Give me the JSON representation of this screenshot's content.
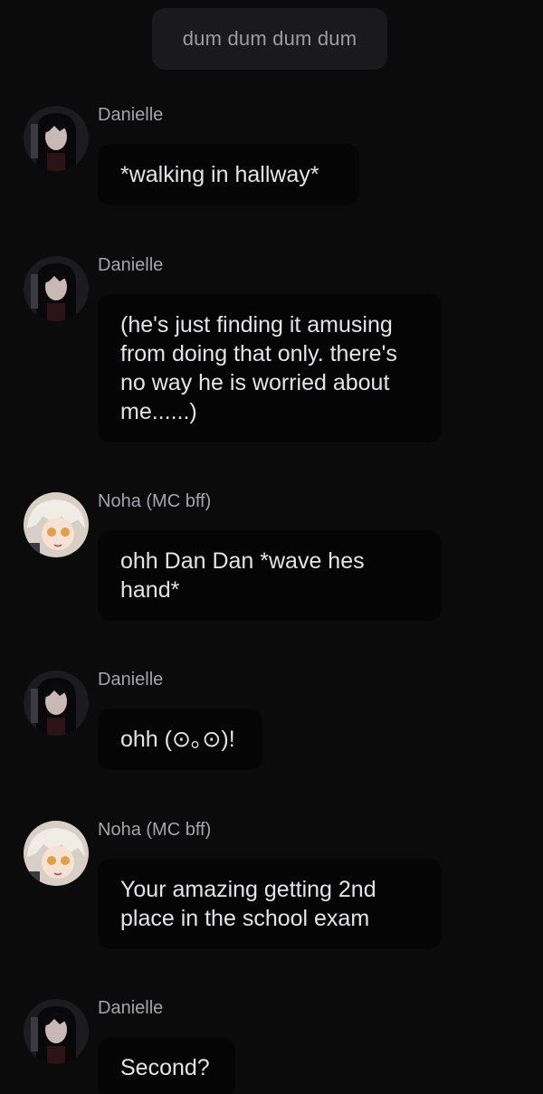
{
  "narration": "dum dum dum dum",
  "messages": [
    {
      "sender": "Danielle",
      "avatar": "danielle-avatar",
      "text": "*walking in hallway*"
    },
    {
      "sender": "Danielle",
      "avatar": "danielle-avatar",
      "text": "(he's just finding it amusing from doing that only. there's no way he is worried about me......)"
    },
    {
      "sender": "Noha (MC bff)",
      "avatar": "noha-avatar",
      "text": "ohh Dan Dan *wave hes hand*"
    },
    {
      "sender": "Danielle",
      "avatar": "danielle-avatar",
      "text": "ohh (⊙｡⊙)!"
    },
    {
      "sender": "Noha (MC bff)",
      "avatar": "noha-avatar",
      "text": "Your amazing getting 2nd place in the school exam"
    },
    {
      "sender": "Danielle",
      "avatar": "danielle-avatar",
      "text": "Second?"
    }
  ],
  "colors": {
    "background": "#0b0b0c",
    "bubble": "#050505",
    "narration_bg": "#1a1a1c",
    "text": "#e4e4e7",
    "sender": "#a4a4aa"
  }
}
